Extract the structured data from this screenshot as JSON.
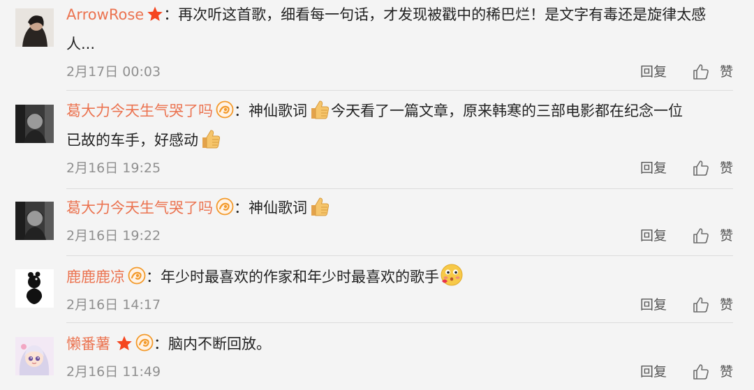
{
  "comments": [
    {
      "author": "ArrowRose",
      "text_line1": "：再次听这首歌，细看每一句话，才发现被戳中的稀巴烂！是文字有毒还是旋律太感",
      "text_line2": "人...",
      "time": "2月17日 00:03",
      "reply_label": "回复",
      "like_label": "赞"
    },
    {
      "author": "葛大力今天生气哭了吗",
      "text_line1a": "：神仙歌词",
      "text_line1b": "今天看了一篇文章，原来韩寒的三部电影都在纪念一位",
      "text_line2": "已故的车手，好感动",
      "time": "2月16日 19:25",
      "reply_label": "回复",
      "like_label": "赞"
    },
    {
      "author": "葛大力今天生气哭了吗",
      "text_line1": "：神仙歌词",
      "time": "2月16日 19:22",
      "reply_label": "回复",
      "like_label": "赞"
    },
    {
      "author": "鹿鹿鹿凉",
      "text_line1": "：年少时最喜欢的作家和年少时最喜欢的歌手",
      "time": "2月16日 14:17",
      "reply_label": "回复",
      "like_label": "赞"
    },
    {
      "author": "懒番薯",
      "text_line1": "：脑内不断回放。",
      "time": "2月16日 11:49",
      "reply_label": "回复",
      "like_label": "赞"
    }
  ],
  "colors": {
    "author_name": "#eb7350",
    "badge_star": "#f5461f",
    "badge_medal": "#f39a2b",
    "meta_text": "#8f8f8f",
    "divider": "#dcdcdc",
    "background": "#f4f4f4"
  },
  "icons": [
    "star-badge-icon",
    "medal-badge-icon",
    "thumbs-up-emoji-icon",
    "blushing-emoji-icon",
    "like-thumb-icon"
  ]
}
